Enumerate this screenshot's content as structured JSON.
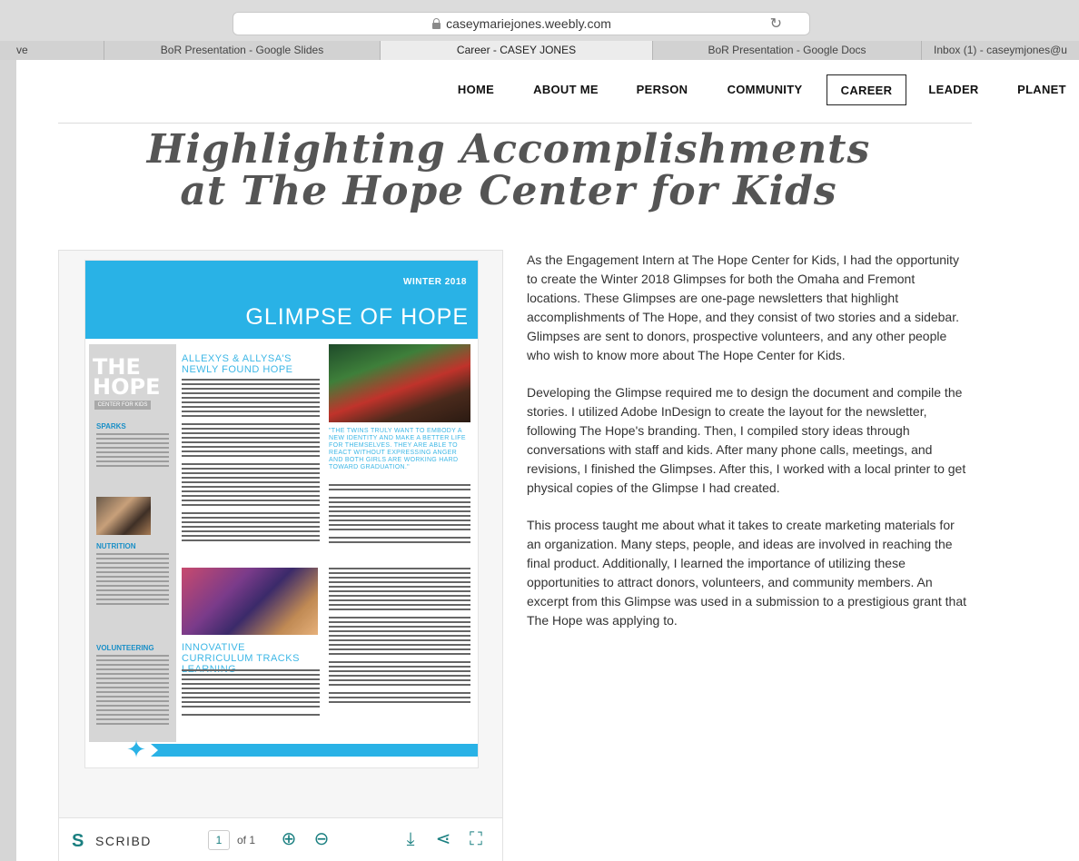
{
  "browser": {
    "url": "caseymariejones.weebly.com",
    "tabs": [
      {
        "label": "ve",
        "active": false
      },
      {
        "label": "BoR Presentation - Google Slides",
        "active": false
      },
      {
        "label": "Career - CASEY JONES",
        "active": true
      },
      {
        "label": "BoR Presentation - Google Docs",
        "active": false
      },
      {
        "label": "Inbox (1) - caseymjones@u",
        "active": false
      }
    ]
  },
  "nav": {
    "items": [
      "HOME",
      "ABOUT ME",
      "PERSON",
      "COMMUNITY",
      "CAREER",
      "LEADER",
      "PLANET"
    ],
    "active": "CAREER"
  },
  "headline": {
    "line1": "Highlighting Accomplishments",
    "line2": "at The Hope Center for Kids"
  },
  "document": {
    "season": "WINTER 2018",
    "title": "GLIMPSE OF HOPE",
    "logo_line1": "THE",
    "logo_line2": "HOPE",
    "logo_sub": "CENTER FOR KIDS",
    "story1_heading": "ALLEXYS & ALLYSA'S NEWLY FOUND HOPE",
    "quote": "\"THE TWINS TRULY WANT TO EMBODY A NEW IDENTITY AND MAKE A BETTER LIFE FOR THEMSELVES. THEY ARE ABLE TO REACT WITHOUT EXPRESSING ANGER AND BOTH GIRLS ARE WORKING HARD TOWARD GRADUATION.\"",
    "story2_heading": "INNOVATIVE CURRICULUM TRACKS LEARNING",
    "sidebar_headings": [
      "SPARKS",
      "NUTRITION",
      "VOLUNTEERING"
    ]
  },
  "viewer": {
    "brand": "SCRIBD",
    "page": "1",
    "of_label": "of 1"
  },
  "article": {
    "paragraphs": [
      "As the Engagement Intern at The Hope Center for Kids, I had the opportunity to create the Winter 2018 Glimpses for both the Omaha and Fremont locations. These Glimpses are one-page newsletters that highlight accomplishments of The Hope, and they consist of two stories and a sidebar. Glimpses are sent to donors, prospective volunteers, and any other people who wish to know more about The Hope Center for Kids.",
      "Developing the Glimpse required me to design the document and compile the stories. I utilized Adobe InDesign to create the layout for the newsletter, following The Hope's branding. Then, I compiled story ideas through conversations with staff and kids. After many phone calls, meetings, and revisions, I finished the Glimpses. After this, I worked with a local printer to get physical copies of the Glimpse I had created.",
      "This process taught me about what it takes to create marketing materials for an organization. Many steps, people, and ideas are involved in reaching the final product. Additionally, I learned the importance of utilizing these opportunities to attract donors, volunteers, and community members. An excerpt from this Glimpse was used in a submission to a prestigious grant that The Hope was applying to."
    ]
  },
  "colors": {
    "accent_blue": "#29b2e6",
    "scribd_teal": "#1a7f80"
  },
  "icons": [
    "lock-icon",
    "reload-icon",
    "zoom-in-icon",
    "zoom-out-icon",
    "download-icon",
    "share-icon",
    "fullscreen-icon",
    "scribd-logo-icon"
  ]
}
